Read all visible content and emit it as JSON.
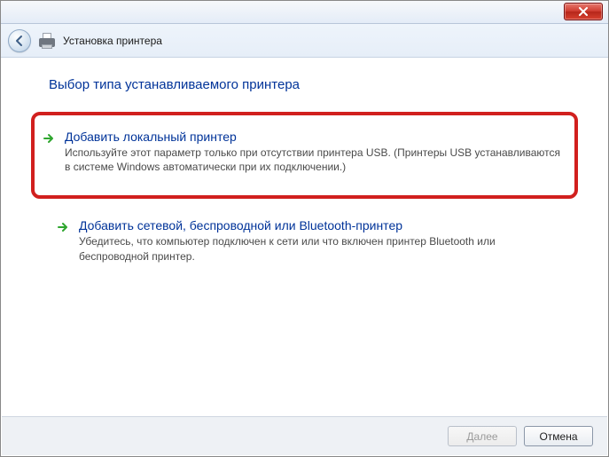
{
  "titlebar": {},
  "header": {
    "title": "Установка принтера"
  },
  "page": {
    "heading": "Выбор типа устанавливаемого принтера"
  },
  "options": [
    {
      "title": "Добавить локальный принтер",
      "desc": "Используйте этот параметр только при отсутствии принтера USB. (Принтеры USB устанавливаются в системе Windows автоматически при их подключении.)",
      "highlighted": true
    },
    {
      "title": "Добавить сетевой, беспроводной или Bluetooth-принтер",
      "desc": "Убедитесь, что компьютер подключен к сети или что включен принтер Bluetooth или беспроводной принтер.",
      "highlighted": false
    }
  ],
  "footer": {
    "next": "Далее",
    "cancel": "Отмена"
  }
}
